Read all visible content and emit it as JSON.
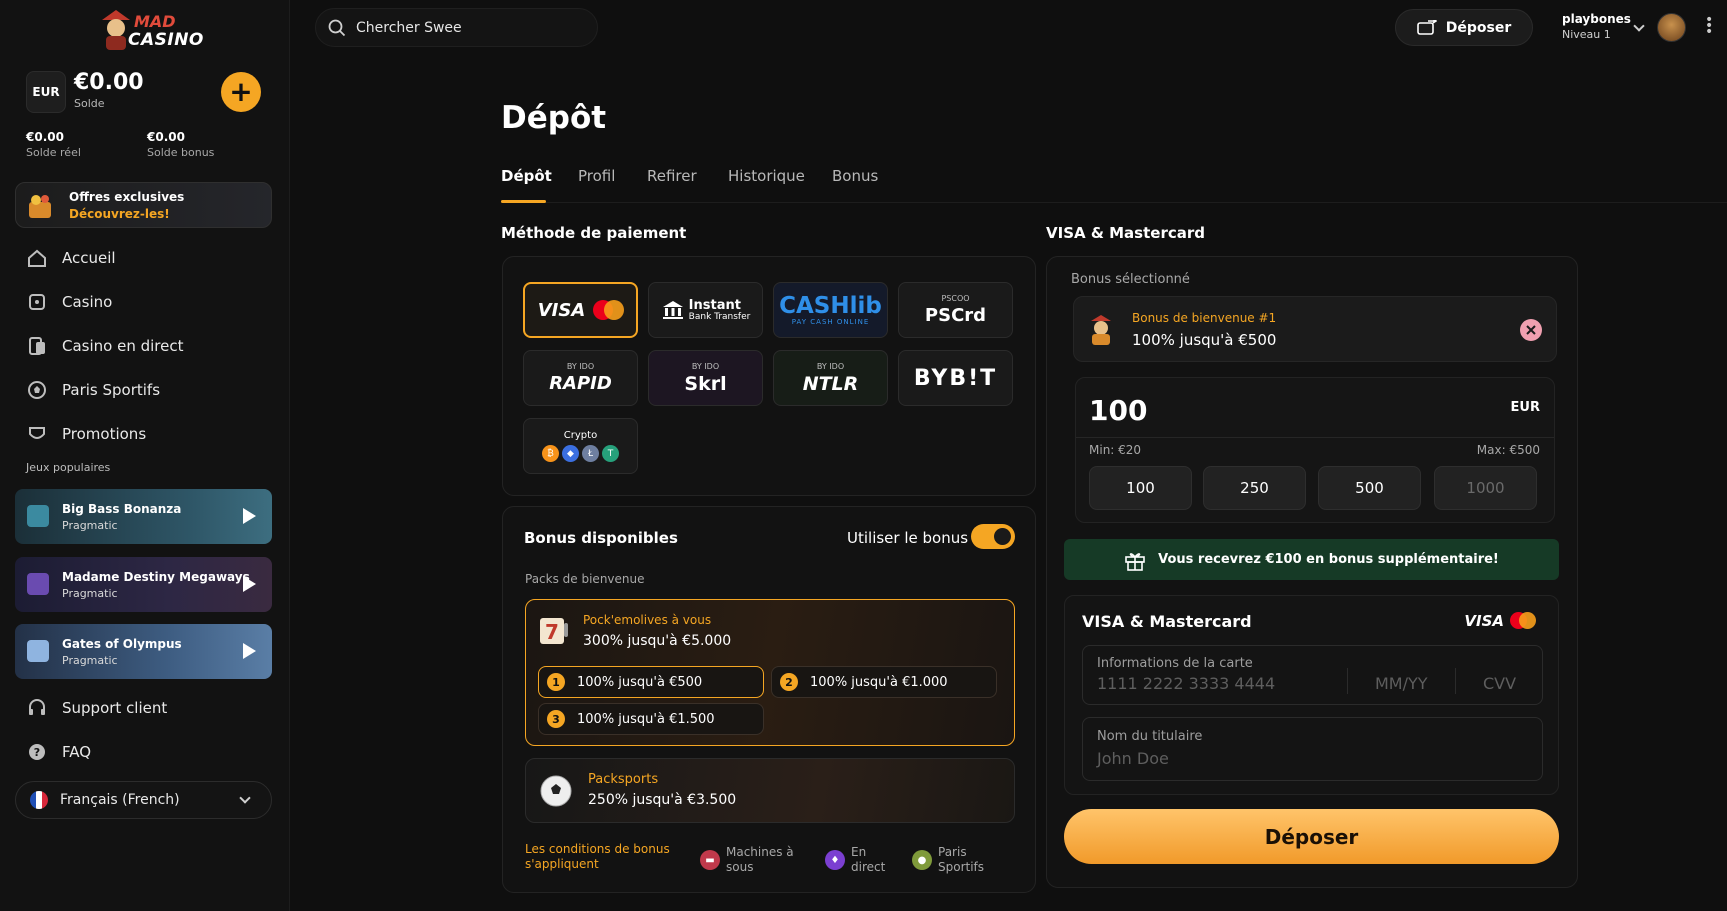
{
  "brand": {
    "line1": "MAD",
    "line2": "CASINO"
  },
  "wallet": {
    "currency": "EUR",
    "balance": "€0.00",
    "balance_label": "Solde",
    "real": "€0.00",
    "real_label": "Solde réel",
    "bonus": "€0.00",
    "bonus_label": "Solde bonus"
  },
  "offer": {
    "title": "Offres exclusives",
    "subtitle": "Découvrez-les!"
  },
  "nav": [
    {
      "label": "Accueil",
      "icon": "home-icon"
    },
    {
      "label": "Casino",
      "icon": "casino-icon"
    },
    {
      "label": "Casino en direct",
      "icon": "live-casino-icon"
    },
    {
      "label": "Paris Sportifs",
      "icon": "soccer-ball-icon"
    },
    {
      "label": "Promotions",
      "icon": "promotions-icon"
    }
  ],
  "popular_label": "Jeux populaires",
  "games": [
    {
      "title": "Big Bass Bonanza",
      "provider": "Pragmatic",
      "color": "#1e3a45"
    },
    {
      "title": "Madame Destiny Megaways",
      "provider": "Pragmatic",
      "color": "#1f1f3a"
    },
    {
      "title": "Gates of Olympus",
      "provider": "Pragmatic",
      "color": "#2c3f5c"
    }
  ],
  "nav_bottom": [
    {
      "label": "Support client",
      "icon": "support-icon"
    },
    {
      "label": "FAQ",
      "icon": "faq-icon"
    }
  ],
  "language": "Français (French)",
  "search": {
    "placeholder": "Chercher Swee"
  },
  "topbar": {
    "deposit_label": "Déposer",
    "username": "playbones",
    "level": "Niveau 1"
  },
  "page": {
    "title": "Dépôt"
  },
  "tabs": [
    "Dépôt",
    "Profil",
    "Refirer",
    "Historique",
    "Bonus"
  ],
  "payment": {
    "heading": "Méthode de paiement",
    "methods": [
      "VISA",
      "Instant",
      "Bank Transfer",
      "CASHlib",
      "PAY CASH ONLINE",
      "PSCOO",
      "PSCrd",
      "BY IDO",
      "RAPID",
      "BY IDO",
      "Skrl",
      "BY IDO",
      "NTLR",
      "BYB!T",
      "Crypto"
    ]
  },
  "bonuses": {
    "heading": "Bonus disponibles",
    "toggle_label": "Utiliser le bonus",
    "packs_label": "Packs de bienvenue",
    "pack1": {
      "name": "Pock'emolives à vous",
      "value": "300% jusqu'à €5.000",
      "options": [
        "100% jusqu'à €500",
        "100% jusqu'à €1.000",
        "100% jusqu'à €1.500"
      ],
      "numbers": [
        "1",
        "2",
        "3"
      ]
    },
    "pack2": {
      "name": "Packsports",
      "value": "250% jusqu'à €3.500"
    },
    "terms": [
      "Les conditions de bonus",
      "s'appliquent"
    ],
    "legend": [
      {
        "l1": "Machines à",
        "l2": "sous",
        "color": "#c0394b"
      },
      {
        "l1": "En",
        "l2": "direct",
        "color": "#7b3fd1"
      },
      {
        "l1": "Paris",
        "l2": "Sportifs",
        "color": "#7f9a3a"
      }
    ]
  },
  "visa": {
    "heading": "VISA & Mastercard",
    "selected_label": "Bonus sélectionné",
    "selected_name": "Bonus de bienvenue #1",
    "selected_value": "100% jusqu'à €500",
    "amount": "100",
    "currency": "EUR",
    "min": "Min: €20",
    "max": "Max: €500",
    "quick": [
      "100",
      "250",
      "500",
      "1000"
    ],
    "banner": "Vous recevrez €100 en bonus supplémentaire!",
    "card_heading": "VISA & Mastercard",
    "card_logo": "VISA",
    "card_info_label": "Informations de la carte",
    "card_number_ph": "1111 2222 3333 4444",
    "expiry_ph": "MM/YY",
    "cvv_ph": "CVV",
    "holder_label": "Nom du titulaire",
    "holder_ph": "John Doe",
    "submit": "Déposer"
  }
}
